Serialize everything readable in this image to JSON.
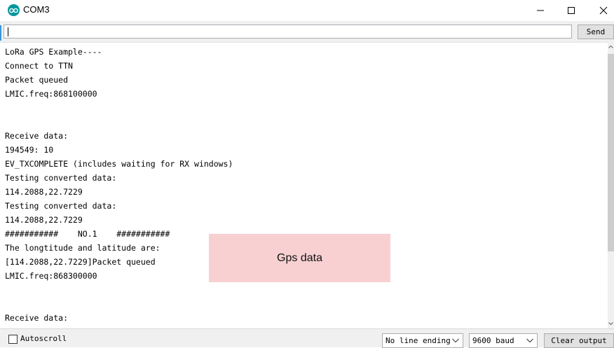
{
  "window": {
    "title": "COM3",
    "app_icon": "arduino-icon"
  },
  "input": {
    "value": "",
    "send_label": "Send"
  },
  "output": {
    "lines": [
      "LoRa GPS Example----",
      "Connect to TTN",
      "Packet queued",
      "LMIC.freq:868100000",
      "",
      "",
      "Receive data:",
      "194549: 10",
      "EV_TXCOMPLETE (includes waiting for RX windows)",
      "Testing converted data:",
      "114.2088,22.7229",
      "Testing converted data:",
      "114.2088,22.7229",
      "###########    NO.1    ###########",
      "The longtitude and latitude are:",
      "[114.2088,22.7229]Packet queued",
      "LMIC.freq:868300000",
      "",
      "",
      "Receive data:"
    ]
  },
  "annotation": {
    "label": "Gps data",
    "color": "#f8d0d2"
  },
  "bottom": {
    "autoscroll_label": "Autoscroll",
    "autoscroll_checked": false,
    "line_ending": "No line ending",
    "baud": "9600 baud",
    "clear_label": "Clear output"
  }
}
